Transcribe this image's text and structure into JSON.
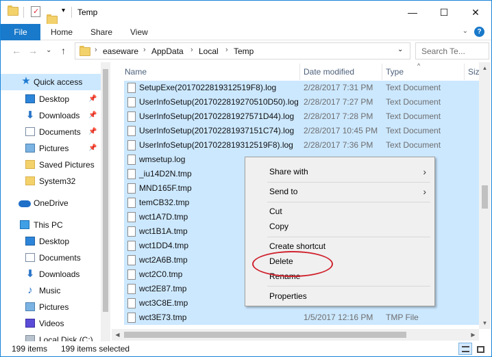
{
  "window": {
    "title": "Temp",
    "controls": {
      "minimize": "—",
      "maximize": "☐",
      "close": "✕"
    }
  },
  "ribbon": {
    "tabs": [
      "File",
      "Home",
      "Share",
      "View"
    ],
    "expand_glyph": "⌄",
    "help_glyph": "?"
  },
  "address": {
    "back": "←",
    "forward": "→",
    "recent": "⌄",
    "up": "↑",
    "crumbs": [
      "easeware",
      "AppData",
      "Local",
      "Temp"
    ],
    "separator": "›",
    "search_placeholder": "Search Te..."
  },
  "navpane": {
    "pin_glyph": "📌",
    "items": [
      {
        "label": "Quick access",
        "icon": "star-icon",
        "selected": true,
        "pinned": false
      },
      {
        "label": "Desktop",
        "icon": "desktop-icon",
        "selected": false,
        "pinned": true
      },
      {
        "label": "Downloads",
        "icon": "download-icon",
        "selected": false,
        "pinned": true
      },
      {
        "label": "Documents",
        "icon": "documents-icon",
        "selected": false,
        "pinned": true
      },
      {
        "label": "Pictures",
        "icon": "pictures-icon",
        "selected": false,
        "pinned": true
      },
      {
        "label": "Saved Pictures",
        "icon": "folder-icon",
        "selected": false,
        "pinned": false
      },
      {
        "label": "System32",
        "icon": "folder-icon",
        "selected": false,
        "pinned": false
      },
      {
        "label": "OneDrive",
        "icon": "cloud-icon",
        "selected": false,
        "pinned": false
      },
      {
        "label": "This PC",
        "icon": "computer-icon",
        "selected": false,
        "pinned": false
      },
      {
        "label": "Desktop",
        "icon": "desktop-icon",
        "selected": false,
        "pinned": false
      },
      {
        "label": "Documents",
        "icon": "documents-icon",
        "selected": false,
        "pinned": false
      },
      {
        "label": "Downloads",
        "icon": "download-icon",
        "selected": false,
        "pinned": false
      },
      {
        "label": "Music",
        "icon": "music-icon",
        "selected": false,
        "pinned": false
      },
      {
        "label": "Pictures",
        "icon": "pictures-icon",
        "selected": false,
        "pinned": false
      },
      {
        "label": "Videos",
        "icon": "videos-icon",
        "selected": false,
        "pinned": false
      },
      {
        "label": "Local Disk (C:)",
        "icon": "disk-icon",
        "selected": false,
        "pinned": false
      }
    ]
  },
  "filelist": {
    "columns": [
      "Name",
      "Date modified",
      "Type",
      "Size"
    ],
    "sort_glyph": "^",
    "rows": [
      {
        "name": "SetupExe(2017022819312519F8).log",
        "date": "2/28/2017 7:31 PM",
        "type": "Text Document"
      },
      {
        "name": "UserInfoSetup(2017022819270510D50).log",
        "date": "2/28/2017 7:27 PM",
        "type": "Text Document"
      },
      {
        "name": "UserInfoSetup(201702281927571D44).log",
        "date": "2/28/2017 7:28 PM",
        "type": "Text Document"
      },
      {
        "name": "UserInfoSetup(201702281937151C74).log",
        "date": "2/28/2017 10:45 PM",
        "type": "Text Document"
      },
      {
        "name": "UserInfoSetup(2017022819312519F8).log",
        "date": "2/28/2017 7:36 PM",
        "type": "Text Document"
      },
      {
        "name": "wmsetup.log",
        "date": "",
        "type": ""
      },
      {
        "name": "_iu14D2N.tmp",
        "date": "",
        "type": ""
      },
      {
        "name": "MND165F.tmp",
        "date": "",
        "type": ""
      },
      {
        "name": "temCB32.tmp",
        "date": "",
        "type": ""
      },
      {
        "name": "wct1A7D.tmp",
        "date": "",
        "type": ""
      },
      {
        "name": "wct1B1A.tmp",
        "date": "",
        "type": ""
      },
      {
        "name": "wct1DD4.tmp",
        "date": "",
        "type": ""
      },
      {
        "name": "wct2A6B.tmp",
        "date": "",
        "type": ""
      },
      {
        "name": "wct2C0.tmp",
        "date": "",
        "type": ""
      },
      {
        "name": "wct2E87.tmp",
        "date": "",
        "type": ""
      },
      {
        "name": "wct3C8E.tmp",
        "date": "",
        "type": ""
      },
      {
        "name": "wct3E73.tmp",
        "date": "1/5/2017 12:16 PM",
        "type": "TMP File"
      }
    ]
  },
  "scroll": {
    "up": "▲",
    "down": "▼",
    "left": "◀",
    "right": "▶"
  },
  "context_menu": {
    "items": [
      {
        "label": "Share with",
        "submenu": true
      },
      {
        "label": "Send to",
        "submenu": true
      },
      {
        "label": "Cut",
        "submenu": false
      },
      {
        "label": "Copy",
        "submenu": false
      },
      {
        "label": "Create shortcut",
        "submenu": false
      },
      {
        "label": "Delete",
        "submenu": false
      },
      {
        "label": "Rename",
        "submenu": false
      },
      {
        "label": "Properties",
        "submenu": false
      }
    ],
    "submenu_glyph": "›",
    "highlighted": "Delete"
  },
  "status": {
    "count": "199 items",
    "selected": "199 items selected"
  },
  "colors": {
    "accent": "#1979ca",
    "selection": "#cce8ff",
    "annotation": "#d0222d"
  }
}
